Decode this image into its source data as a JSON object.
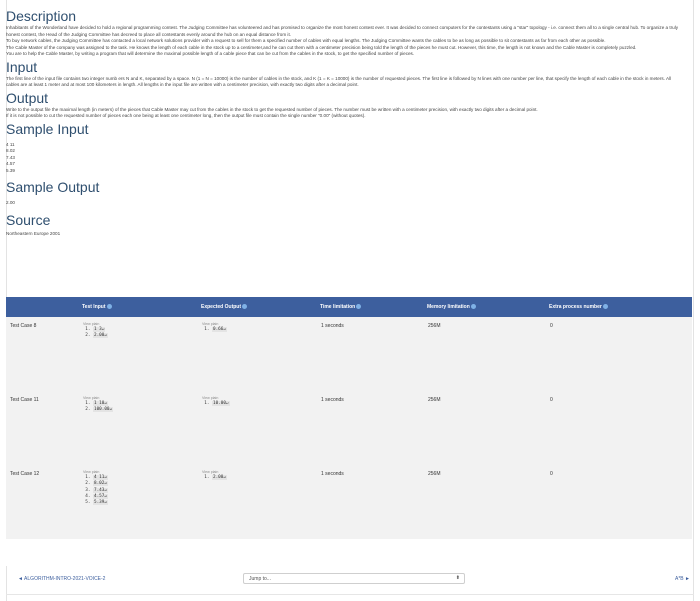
{
  "description": {
    "heading": "Description",
    "paragraphs": [
      "Inhabitants of the Wonderland have decided to hold a regional programming contest. The Judging Committee has volunteered and has promised to organize the most honest contest ever. It was decided to connect computers for the contestants using a \"star\" topology - i.e. connect them all to a single central hub. To organize a truly honest contest, the Head of the Judging Committee has decreed to place all contestants evenly around the hub on an equal distance from it.",
      "To buy network cables, the Judging Committee has contacted a local network solutions provider with a request to sell for them a specified number of cables with equal lengths. The Judging Committee wants the cables to be as long as possible to sit contestants as far from each other as possible.",
      "The Cable Master of the company was assigned to the task. He knows the length of each cable in the stock up to a centimeter,and he can cut them with a centimeter precision being told the length of the pieces he must cut. However, this time, the length is not known and the Cable Master is completely puzzled.",
      "You are to help the Cable Master, by writing a program that will determine the maximal possible length of a cable piece that can be cut from the cables in the stock, to get the specified number of pieces."
    ]
  },
  "input": {
    "heading": "Input",
    "paragraphs": [
      "The first line of the input file contains two integer numb ers N and K, separated by a space. N (1 = N = 10000) is the number of cables in the stock, and K (1 = K = 10000) is the number of requested pieces. The first line is followed by N lines with one number per line, that specify the length of each cable in the stock in meters. All cables are at least 1 meter and at most 100 kilometers in length. All lengths in the input file are written with a centimeter precision, with exactly two digits after a decimal point."
    ]
  },
  "output": {
    "heading": "Output",
    "paragraphs": [
      "Write to the output file the maximal length (in meters) of the pieces that Cable Master may cut from the cables in the stock to get the requested number of pieces. The number must be written with a centimeter precision, with exactly two digits after a decimal point.",
      "If it is not possible to cut the requested number of pieces each one being at least one centimeter long, then the output file must contain the single number \"0.00\" (without quotes)."
    ]
  },
  "sample_input": {
    "heading": "Sample Input",
    "lines": [
      "4 11",
      "8.02",
      "7.43",
      "4.57",
      "5.39"
    ]
  },
  "sample_output": {
    "heading": "Sample Output",
    "lines": [
      "2.00"
    ]
  },
  "source": {
    "heading": "Source",
    "text": "Northeastern Europe 2001"
  },
  "table": {
    "headers": {
      "test": "",
      "test_input": "Test Input",
      "expected_output": "Expected Output",
      "time_limitation": "Time limitation",
      "memory_limitation": "Memory limitation",
      "extra_process_number": "Extra process number"
    },
    "view_plain_label": "View plain",
    "rows": [
      {
        "name": "Test Case 8",
        "input": [
          "1 3↵",
          "2.00↵"
        ],
        "output": [
          "0.66↵"
        ],
        "time": "1 seconds",
        "memory": "256M",
        "extra": "0"
      },
      {
        "name": "Test Case 11",
        "input": [
          "1 10↵",
          "100.00↵"
        ],
        "output": [
          "10.00↵"
        ],
        "time": "1 seconds",
        "memory": "256M",
        "extra": "0"
      },
      {
        "name": "Test Case 12",
        "input": [
          "4 11↵",
          "8.02↵",
          "7.43↵",
          "4.57↵",
          "5.39↵"
        ],
        "output": [
          "2.00↵"
        ],
        "time": "1 seconds",
        "memory": "256M",
        "extra": "0"
      }
    ]
  },
  "footer": {
    "prev_label": "◄ ALGORITHM-INTRO-2021-VOICE-2",
    "jump_label": "Jump to...",
    "jump_arrows": "⬍",
    "next_label": "A*B ►"
  },
  "colors": {
    "heading": "#2f4f6f",
    "table_header_bg": "#3d5f9e",
    "link": "#3d5f9e"
  }
}
